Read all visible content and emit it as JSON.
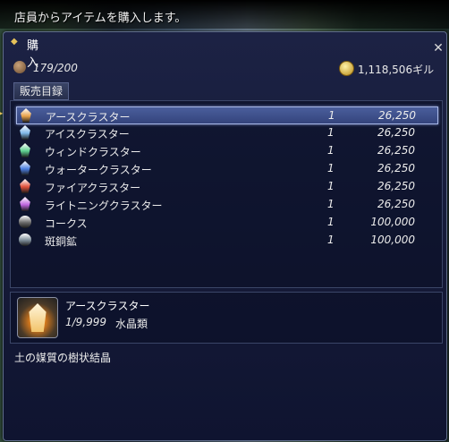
{
  "hint": {
    "text": "店員からアイテムを購入します。"
  },
  "window": {
    "title": "購入",
    "inventory_count": "179/200",
    "gil_amount": "1,118,506ギル",
    "tab_label": "販売目録",
    "close_symbol": "✕"
  },
  "items": [
    {
      "name": "アースクラスター",
      "qty": "1",
      "price": "26,250",
      "icon": "earth-cluster-icon",
      "color": "#e8a24a"
    },
    {
      "name": "アイスクラスター",
      "qty": "1",
      "price": "26,250",
      "icon": "ice-cluster-icon",
      "color": "#7fb8e8"
    },
    {
      "name": "ウィンドクラスター",
      "qty": "1",
      "price": "26,250",
      "icon": "wind-cluster-icon",
      "color": "#5ed090"
    },
    {
      "name": "ウォータークラスター",
      "qty": "1",
      "price": "26,250",
      "icon": "water-cluster-icon",
      "color": "#4a7ee0"
    },
    {
      "name": "ファイアクラスター",
      "qty": "1",
      "price": "26,250",
      "icon": "fire-cluster-icon",
      "color": "#e0503a"
    },
    {
      "name": "ライトニングクラスター",
      "qty": "1",
      "price": "26,250",
      "icon": "lightning-cluster-icon",
      "color": "#c066e0"
    },
    {
      "name": "コークス",
      "qty": "1",
      "price": "100,000",
      "icon": "coke-icon",
      "color": "#6a6a6a"
    },
    {
      "name": "斑銅鉱",
      "qty": "1",
      "price": "100,000",
      "icon": "bornite-icon",
      "color": "#7a8a96"
    }
  ],
  "detail": {
    "name": "アースクラスター",
    "stock": "1/9,999",
    "category": "水晶類",
    "description": "土の媒質の樹状結晶"
  }
}
